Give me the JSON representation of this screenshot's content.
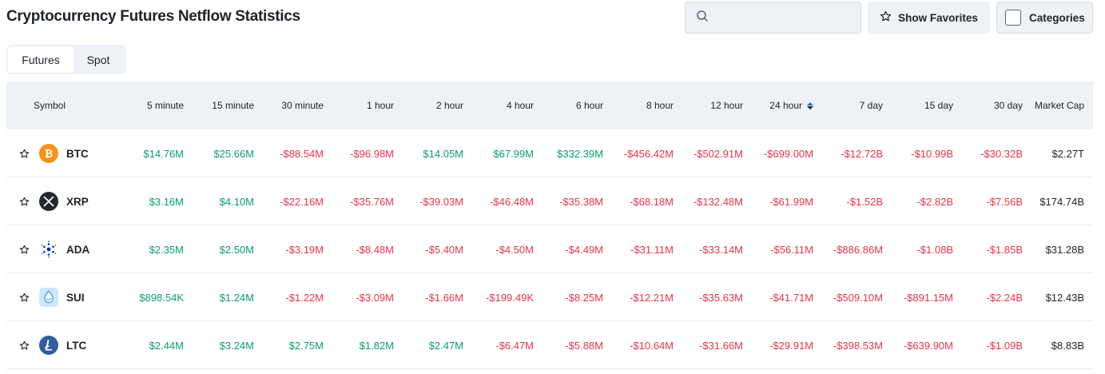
{
  "page_title": "Cryptocurrency Futures Netflow Statistics",
  "search": {
    "placeholder": "",
    "value": ""
  },
  "toolbar": {
    "show_favorites": "Show Favorites",
    "categories": "Categories"
  },
  "tabs": [
    {
      "label": "Futures",
      "active": true
    },
    {
      "label": "Spot",
      "active": false
    }
  ],
  "colors": {
    "positive": "#0a9c72",
    "negative": "#e8354a",
    "header_bg": "#eef1f5"
  },
  "table": {
    "headers": [
      "Symbol",
      "5 minute",
      "15 minute",
      "30 minute",
      "1 hour",
      "2 hour",
      "4 hour",
      "6 hour",
      "8 hour",
      "12 hour",
      "24 hour",
      "7 day",
      "15 day",
      "30 day",
      "Market Cap"
    ],
    "sorted_column": "24 hour",
    "rows": [
      {
        "symbol": "BTC",
        "icon": "bitcoin-icon",
        "values": [
          "$14.76M",
          "$25.66M",
          "-$88.54M",
          "-$96.98M",
          "$14.05M",
          "$67.99M",
          "$332.39M",
          "-$456.42M",
          "-$502.91M",
          "-$699.00M",
          "-$12.72B",
          "-$10.99B",
          "-$30.32B"
        ],
        "market_cap": "$2.27T"
      },
      {
        "symbol": "XRP",
        "icon": "xrp-icon",
        "values": [
          "$3.16M",
          "$4.10M",
          "-$22.16M",
          "-$35.76M",
          "-$39.03M",
          "-$46.48M",
          "-$35.38M",
          "-$68.18M",
          "-$132.48M",
          "-$61.99M",
          "-$1.52B",
          "-$2.82B",
          "-$7.56B"
        ],
        "market_cap": "$174.74B"
      },
      {
        "symbol": "ADA",
        "icon": "cardano-icon",
        "values": [
          "$2.35M",
          "$2.50M",
          "-$3.19M",
          "-$8.48M",
          "-$5.40M",
          "-$4.50M",
          "-$4.49M",
          "-$31.11M",
          "-$33.14M",
          "-$56.11M",
          "-$886.86M",
          "-$1.08B",
          "-$1.85B"
        ],
        "market_cap": "$31.28B"
      },
      {
        "symbol": "SUI",
        "icon": "sui-icon",
        "values": [
          "$898.54K",
          "$1.24M",
          "-$1.22M",
          "-$3.09M",
          "-$1.66M",
          "-$199.49K",
          "-$8.25M",
          "-$12.21M",
          "-$35.63M",
          "-$41.71M",
          "-$509.10M",
          "-$891.15M",
          "-$2.24B"
        ],
        "market_cap": "$12.43B"
      },
      {
        "symbol": "LTC",
        "icon": "litecoin-icon",
        "values": [
          "$2.44M",
          "$3.24M",
          "$2.75M",
          "$1.82M",
          "$2.47M",
          "-$6.47M",
          "-$5.88M",
          "-$10.64M",
          "-$31.66M",
          "-$29.91M",
          "-$398.53M",
          "-$639.90M",
          "-$1.09B"
        ],
        "market_cap": "$8.83B"
      }
    ]
  }
}
